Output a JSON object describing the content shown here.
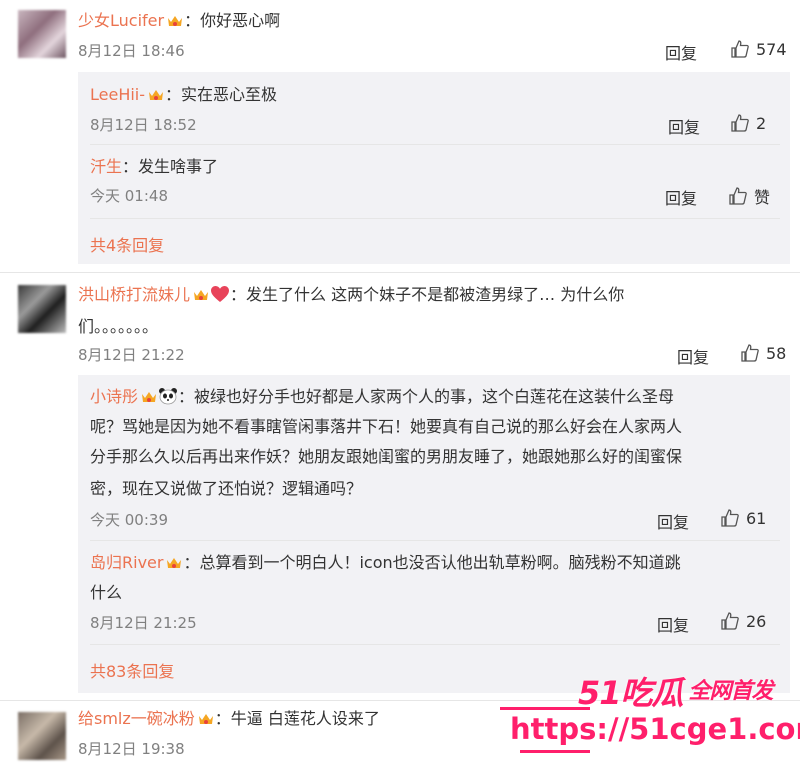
{
  "comments": [
    {
      "user": "少女Lucifer",
      "text": "你好恶心啊",
      "time": "8月12日 18:46",
      "reply_label": "回复",
      "likes": "574",
      "replies": [
        {
          "user": "LeeHii-",
          "text": "实在恶心至极",
          "time": "8月12日 18:52",
          "reply_label": "回复",
          "likes": "2"
        },
        {
          "user": "汘生",
          "text": "发生啥事了",
          "time": "今天 01:48",
          "reply_label": "回复",
          "likes": "赞"
        }
      ],
      "more_replies": "共4条回复"
    },
    {
      "user": "洪山桥打流妹儿",
      "text_line1": "发生了什么 这两个妹子不是都被渣男绿了… 为什么你",
      "text_line2": "们。。。。。。。",
      "time": "8月12日 21:22",
      "reply_label": "回复",
      "likes": "58",
      "replies": [
        {
          "user": "小诗彤",
          "lines": [
            "被绿也好分手也好都是人家两个人的事，这个白莲花在这装什么圣母",
            "呢？骂她是因为她不看事瞎管闲事落井下石！她要真有自己说的那么好会在人家两人",
            "分手那么久以后再出来作妖？她朋友跟她闺蜜的男朋友睡了，她跟她那么好的闺蜜保",
            "密，现在又说做了还怕说？逻辑通吗？"
          ],
          "time": "今天 00:39",
          "reply_label": "回复",
          "likes": "61"
        },
        {
          "user": "岛归River",
          "lines": [
            "总算看到一个明白人！icon也没否认他出轨草粉啊。脑残粉不知道跳",
            "什么"
          ],
          "time": "8月12日 21:25",
          "reply_label": "回复",
          "likes": "26"
        }
      ],
      "more_replies": "共83条回复"
    },
    {
      "user": "给smlz一碗冰粉",
      "text": "牛逼 白莲花人设来了",
      "time": "8月12日 19:38"
    }
  ],
  "colon": "：",
  "watermark": {
    "line1": "51吃瓜",
    "line1b": "全网首发",
    "line2": "https://51cge1.com"
  },
  "colors": {
    "username": "#eb7350",
    "reply_box": "#f2f2f5",
    "watermark": "#ff1f6b"
  }
}
